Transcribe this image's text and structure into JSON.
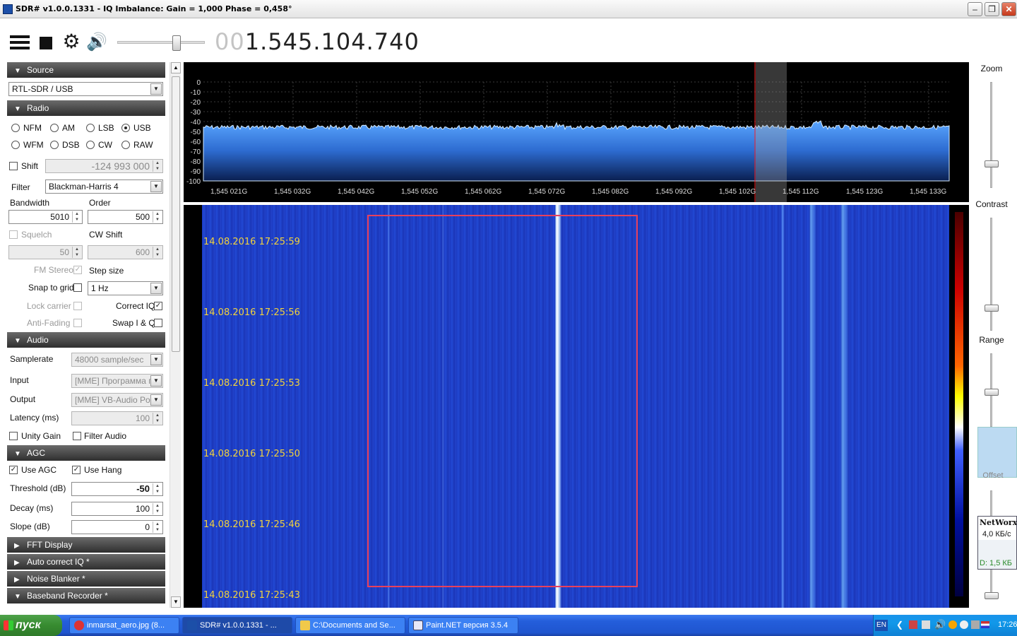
{
  "window": {
    "title": "SDR# v1.0.0.1331 - IQ Imbalance: Gain = 1,000 Phase = 0,458°"
  },
  "toolbar": {
    "freq_prefix": "00",
    "freq_main": "1.545.104.740"
  },
  "source": {
    "header": "Source",
    "device": "RTL-SDR / USB"
  },
  "radio": {
    "header": "Radio",
    "modes": [
      "NFM",
      "AM",
      "LSB",
      "USB",
      "WFM",
      "DSB",
      "CW",
      "RAW"
    ],
    "selected_mode": "USB",
    "shift_label": "Shift",
    "shift_value": "-124 993 000",
    "filter_label": "Filter",
    "filter_value": "Blackman-Harris 4",
    "bandwidth_label": "Bandwidth",
    "bandwidth_value": "5010",
    "order_label": "Order",
    "order_value": "500",
    "squelch_label": "Squelch",
    "squelch_value": "50",
    "cwshift_label": "CW Shift",
    "cwshift_value": "600",
    "fmstereo_label": "FM Stereo",
    "stepsize_label": "Step size",
    "snap_label": "Snap to grid",
    "step_value": "1 Hz",
    "lock_label": "Lock carrier",
    "correctiq_label": "Correct IQ",
    "antifading_label": "Anti-Fading",
    "swapiq_label": "Swap I & Q"
  },
  "audio": {
    "header": "Audio",
    "samplerate_label": "Samplerate",
    "samplerate_value": "48000 sample/sec",
    "input_label": "Input",
    "input_value": "[MME] Программа пе",
    "output_label": "Output",
    "output_value": "[MME] VB-Audio Point",
    "latency_label": "Latency (ms)",
    "latency_value": "100",
    "unity_label": "Unity Gain",
    "filteraudio_label": "Filter Audio"
  },
  "agc": {
    "header": "AGC",
    "use_agc_label": "Use AGC",
    "use_hang_label": "Use Hang",
    "threshold_label": "Threshold (dB)",
    "threshold_value": "-50",
    "decay_label": "Decay (ms)",
    "decay_value": "100",
    "slope_label": "Slope (dB)",
    "slope_value": "0"
  },
  "collapsed": [
    "FFT Display",
    "Auto correct IQ *",
    "Noise Blanker *",
    "Baseband Recorder *"
  ],
  "spectrum": {
    "db_labels": [
      "0",
      "-10",
      "-20",
      "-30",
      "-40",
      "-50",
      "-60",
      "-70",
      "-80",
      "-90",
      "-100"
    ],
    "freq_labels": [
      "1,545 021G",
      "1,545 032G",
      "1,545 042G",
      "1,545 052G",
      "1,545 062G",
      "1,545 072G",
      "1,545 082G",
      "1,545 092G",
      "1,545 102G",
      "1,545 112G",
      "1,545 123G",
      "1,545 133G"
    ]
  },
  "waterfall": {
    "timestamps": [
      "14.08.2016 17:25:59",
      "14.08.2016 17:25:56",
      "14.08.2016 17:25:53",
      "14.08.2016 17:25:50",
      "14.08.2016 17:25:46",
      "14.08.2016 17:25:43"
    ]
  },
  "right": {
    "zoom": "Zoom",
    "contrast": "Contrast",
    "range": "Range",
    "offset": "Offset"
  },
  "networx": {
    "title": "NetWorx",
    "rate": "4,0 КБ/с",
    "down": "D: 1,5 КБ"
  },
  "taskbar": {
    "start": "пуск",
    "tasks": [
      "inmarsat_aero.jpg (8...",
      "SDR# v1.0.0.1331 - ...",
      "C:\\Documents and Se...",
      "Paint.NET версия 3.5.4"
    ],
    "lang": "EN",
    "clock": "17:26"
  }
}
